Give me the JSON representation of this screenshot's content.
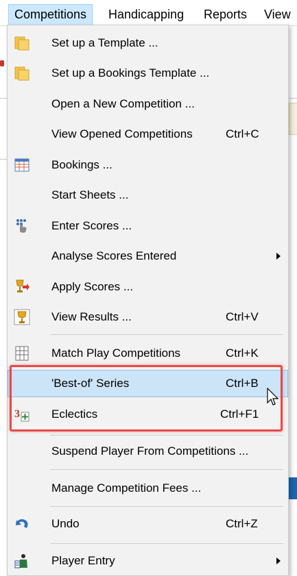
{
  "menubar": {
    "items": [
      {
        "label": "Competitions",
        "active": true
      },
      {
        "label": "Handicapping",
        "active": false
      },
      {
        "label": "Reports",
        "active": false
      },
      {
        "label": "View",
        "active": false
      }
    ]
  },
  "menu": {
    "items": [
      {
        "label": "Set up a Template ...",
        "shortcut": "",
        "icon": "folder-icon",
        "submenu": false
      },
      {
        "label": "Set up a Bookings Template ...",
        "shortcut": "",
        "icon": "folder-icon",
        "submenu": false
      },
      {
        "label": "Open a New Competition ...",
        "shortcut": "",
        "icon": "",
        "submenu": false
      },
      {
        "label": "View Opened Competitions",
        "shortcut": "Ctrl+C",
        "icon": "",
        "submenu": false
      },
      {
        "label": "Bookings ...",
        "shortcut": "",
        "icon": "calendar-grid-icon",
        "submenu": false
      },
      {
        "label": "Start Sheets ...",
        "shortcut": "",
        "icon": "",
        "submenu": false
      },
      {
        "label": "Enter Scores ...",
        "shortcut": "",
        "icon": "keypad-hand-icon",
        "submenu": false
      },
      {
        "label": "Analyse Scores Entered",
        "shortcut": "",
        "icon": "",
        "submenu": true
      },
      {
        "label": "Apply Scores ...",
        "shortcut": "",
        "icon": "trophy-arrow-icon",
        "submenu": false
      },
      {
        "label": "View Results ...",
        "shortcut": "Ctrl+V",
        "icon": "trophy-icon",
        "submenu": false
      },
      {
        "label": "Match Play Competitions",
        "shortcut": "Ctrl+K",
        "icon": "bracket-grid-icon",
        "submenu": false
      },
      {
        "label": "'Best-of' Series",
        "shortcut": "Ctrl+B",
        "icon": "",
        "submenu": false,
        "highlighted": true
      },
      {
        "label": "Eclectics",
        "shortcut": "Ctrl+F1",
        "icon": "eclectic-three-plus-icon",
        "submenu": false
      },
      {
        "label": "Suspend Player From Competitions ...",
        "shortcut": "",
        "icon": "",
        "submenu": false
      },
      {
        "label": "Manage Competition Fees ...",
        "shortcut": "",
        "icon": "",
        "submenu": false
      },
      {
        "label": "Undo",
        "shortcut": "Ctrl+Z",
        "icon": "undo-icon",
        "submenu": false
      },
      {
        "label": "Player Entry",
        "shortcut": "",
        "icon": "player-entry-icon",
        "submenu": true
      }
    ]
  },
  "colors": {
    "highlight_bg": "#cce4f7",
    "annotation_border": "#e64a4a",
    "menu_bg": "#f2f2f2"
  }
}
